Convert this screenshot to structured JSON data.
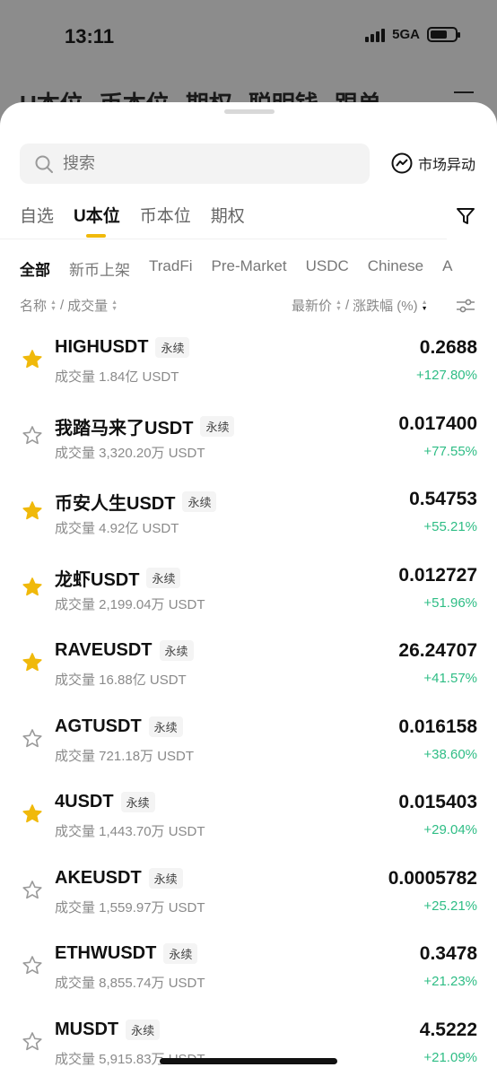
{
  "status_bar": {
    "time": "13:11",
    "network": "5GA"
  },
  "background_tabs": [
    "U本位",
    "币本位",
    "期权",
    "聪明钱",
    "跟单"
  ],
  "search": {
    "placeholder": "搜索",
    "market_button": "市场异动"
  },
  "tabs": [
    "自选",
    "U本位",
    "币本位",
    "期权"
  ],
  "active_tab": "U本位",
  "subtabs": [
    "全部",
    "新币上架",
    "TradFi",
    "Pre-Market",
    "USDC",
    "Chinese",
    "A"
  ],
  "active_subtab": "全部",
  "columns": {
    "name": "名称",
    "sep1": "/",
    "volume": "成交量",
    "last_price": "最新价",
    "sep2": "/",
    "change": "涨跌幅 (%)"
  },
  "colors": {
    "accent": "#f0b90b",
    "up": "#2ebd85",
    "star_on": "#f0b90b",
    "star_off": "#9a9a9a"
  },
  "rows": [
    {
      "pair": "HIGHUSDT",
      "badge": "永续",
      "volume": "成交量 1.84亿 USDT",
      "price": "0.2688",
      "change": "+127.80%",
      "favorite": true
    },
    {
      "pair": "我踏马来了USDT",
      "badge": "永续",
      "volume": "成交量 3,320.20万 USDT",
      "price": "0.017400",
      "change": "+77.55%",
      "favorite": false
    },
    {
      "pair": "币安人生USDT",
      "badge": "永续",
      "volume": "成交量 4.92亿 USDT",
      "price": "0.54753",
      "change": "+55.21%",
      "favorite": true
    },
    {
      "pair": "龙虾USDT",
      "badge": "永续",
      "volume": "成交量 2,199.04万 USDT",
      "price": "0.012727",
      "change": "+51.96%",
      "favorite": true
    },
    {
      "pair": "RAVEUSDT",
      "badge": "永续",
      "volume": "成交量 16.88亿 USDT",
      "price": "26.24707",
      "change": "+41.57%",
      "favorite": true
    },
    {
      "pair": "AGTUSDT",
      "badge": "永续",
      "volume": "成交量 721.18万 USDT",
      "price": "0.016158",
      "change": "+38.60%",
      "favorite": false
    },
    {
      "pair": "4USDT",
      "badge": "永续",
      "volume": "成交量 1,443.70万 USDT",
      "price": "0.015403",
      "change": "+29.04%",
      "favorite": true
    },
    {
      "pair": "AKEUSDT",
      "badge": "永续",
      "volume": "成交量 1,559.97万 USDT",
      "price": "0.0005782",
      "change": "+25.21%",
      "favorite": false
    },
    {
      "pair": "ETHWUSDT",
      "badge": "永续",
      "volume": "成交量 8,855.74万 USDT",
      "price": "0.3478",
      "change": "+21.23%",
      "favorite": false
    },
    {
      "pair": "MUSDT",
      "badge": "永续",
      "volume": "成交量 5,915.83万 USDT",
      "price": "4.5222",
      "change": "+21.09%",
      "favorite": false
    }
  ]
}
